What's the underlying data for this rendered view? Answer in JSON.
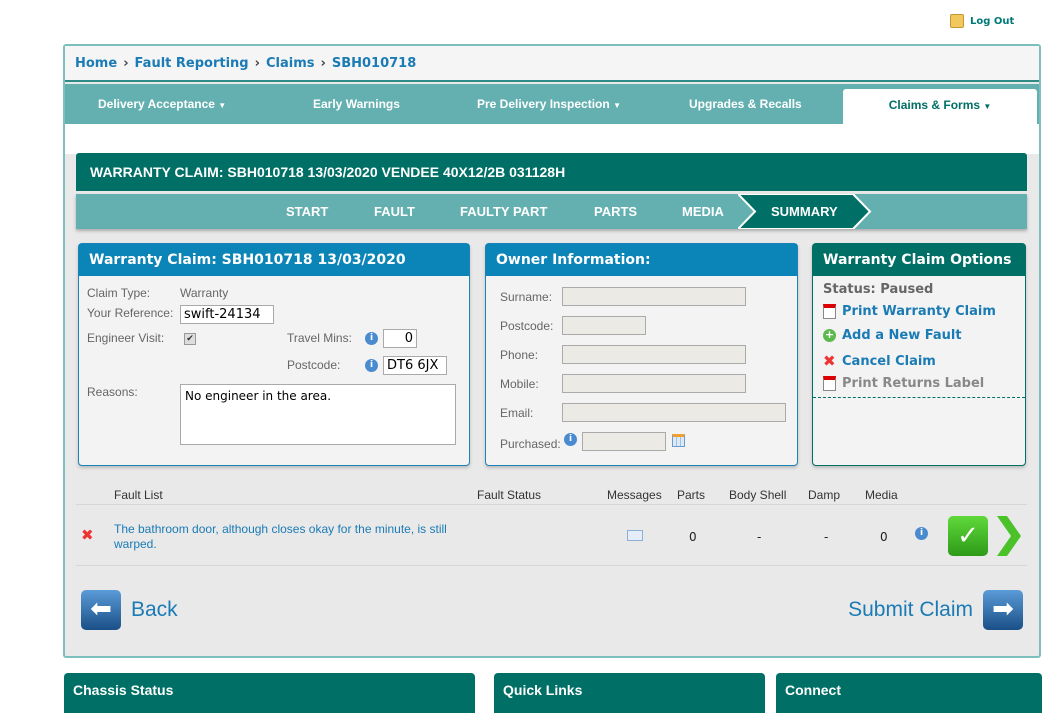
{
  "header": {
    "logout": "Log Out"
  },
  "breadcrumb": [
    "Home",
    "Fault Reporting",
    "Claims",
    "SBH010718"
  ],
  "nav": [
    {
      "label": "Delivery Acceptance",
      "dropdown": true
    },
    {
      "label": "Early Warnings"
    },
    {
      "label": "Pre Delivery Inspection",
      "dropdown": true
    },
    {
      "label": "Upgrades & Recalls"
    },
    {
      "label": "Claims & Forms",
      "dropdown": true,
      "active": true
    }
  ],
  "title": "WARRANTY CLAIM: SBH010718 13/03/2020 VENDEE 40X12/2B 031128H",
  "steps": [
    "START",
    "FAULT",
    "FAULTY PART",
    "PARTS",
    "MEDIA",
    "SUMMARY"
  ],
  "claim": {
    "title": "Warranty Claim: SBH010718 13/03/2020",
    "type_label": "Claim Type:",
    "type_value": "Warranty",
    "ref_label": "Your Reference:",
    "ref_value": "swift-24134",
    "engineer_label": "Engineer Visit:",
    "engineer_checked": true,
    "travel_label": "Travel Mins:",
    "travel_value": "0",
    "postcode_label": "Postcode:",
    "postcode_value": "DT6 6JX",
    "reasons_label": "Reasons:",
    "reasons_value": "No engineer in the area."
  },
  "owner": {
    "title": "Owner Information:",
    "surname": "Surname:",
    "postcode": "Postcode:",
    "phone": "Phone:",
    "mobile": "Mobile:",
    "email": "Email:",
    "purchased": "Purchased:"
  },
  "options": {
    "title": "Warranty Claim Options",
    "status": "Status: Paused",
    "print": "Print Warranty Claim",
    "add": "Add a New Fault",
    "cancel": "Cancel Claim",
    "returns": "Print Returns Label"
  },
  "faults": {
    "headers": [
      "Fault List",
      "Fault Status",
      "Messages",
      "Parts",
      "Body Shell",
      "Damp",
      "Media"
    ],
    "rows": [
      {
        "text": "The bathroom door, although closes okay for the minute, is still warped.",
        "parts": "0",
        "body_shell": "-",
        "damp": "-",
        "media": "0"
      }
    ]
  },
  "actions": {
    "back": "Back",
    "submit": "Submit Claim"
  },
  "footer": [
    "Chassis Status",
    "Quick Links",
    "Connect"
  ]
}
